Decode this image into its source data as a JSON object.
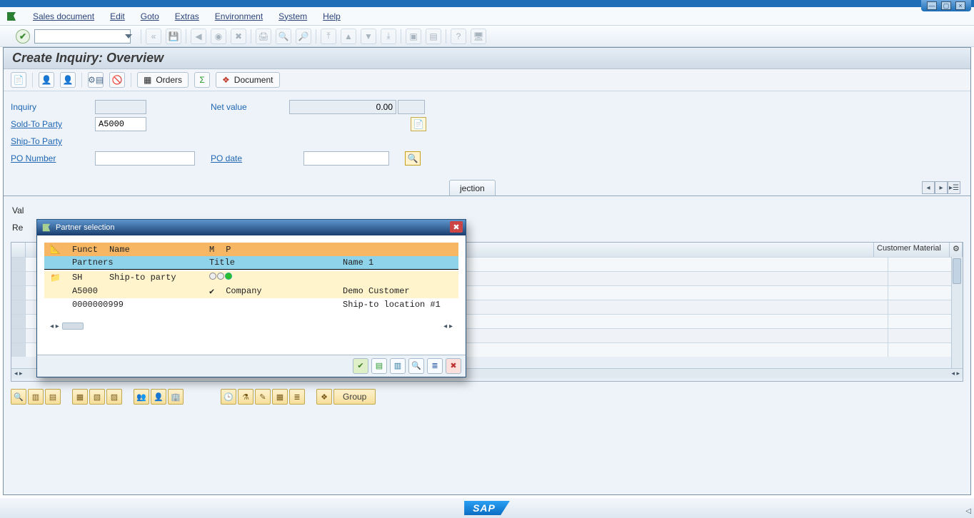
{
  "window": {
    "controls": {
      "min": "—",
      "restore": "▢",
      "close": "×"
    }
  },
  "menu": {
    "items": [
      "Sales document",
      "Edit",
      "Goto",
      "Extras",
      "Environment",
      "System",
      "Help"
    ]
  },
  "title": "Create Inquiry: Overview",
  "app_toolbar": {
    "orders_label": "Orders",
    "document_label": "Document"
  },
  "header": {
    "inquiry_label": "Inquiry",
    "inquiry_value": "",
    "net_value_label": "Net value",
    "net_value_value": "0.00",
    "currency": "",
    "sold_to_label": "Sold-To Party",
    "sold_to_value": "A5000",
    "ship_to_label": "Ship-To Party",
    "ship_to_value": "",
    "po_number_label": "PO Number",
    "po_number_value": "",
    "po_date_label": "PO date",
    "po_date_value": ""
  },
  "tabs": {
    "visible_suffix": "jection",
    "val_prefix": "Val",
    "req_prefix": "Re"
  },
  "grid": {
    "cust_mat_label": "Customer Material",
    "scroll_left": "◂ ▸",
    "scroll_right": "◂ ▸"
  },
  "modal": {
    "title": "Partner selection",
    "hdr1": {
      "funct": "Funct",
      "name": "Name",
      "m": "M",
      "p": "P"
    },
    "hdr2": {
      "partners": "Partners",
      "title": "Title",
      "name1": "Name 1"
    },
    "row_sh": {
      "funct": "SH",
      "name": "Ship-to party"
    },
    "row_a5000": {
      "partner": "A5000",
      "check": "✔",
      "title": "Company",
      "name1": "Demo Customer"
    },
    "row_999": {
      "partner": "0000000999",
      "name1": "Ship-to location #1"
    },
    "scroll_left": "◂ ▸",
    "scroll_right": "◂ ▸"
  },
  "footer": {
    "group_label": "Group"
  },
  "sap_logo": "SAP"
}
